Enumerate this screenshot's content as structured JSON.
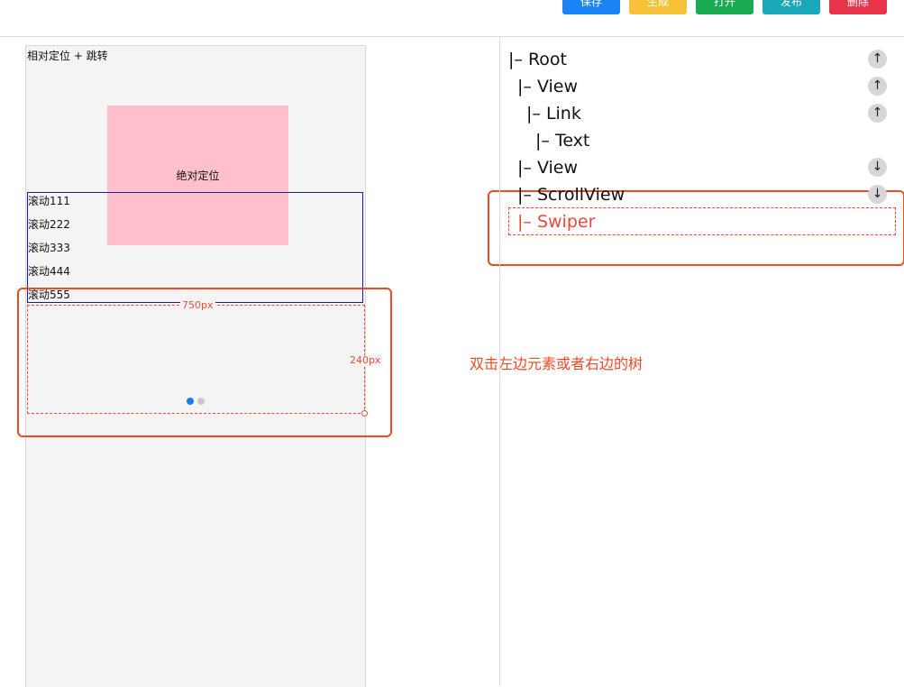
{
  "toolbar": {
    "buttons": [
      {
        "label": "保存",
        "color": "#1a84f7"
      },
      {
        "label": "生成",
        "color": "#f7c23a"
      },
      {
        "label": "打开",
        "color": "#1aaa52"
      },
      {
        "label": "发布",
        "color": "#1aa8b8"
      },
      {
        "label": "删除",
        "color": "#e8344b"
      }
    ]
  },
  "canvas": {
    "link_text": "相对定位 + 跳转",
    "absolute_box_text": "绝对定位",
    "scroll_items": [
      "滚动111",
      "滚动222",
      "滚动333",
      "滚动444",
      "滚动555"
    ],
    "swiper": {
      "width_label": "750px",
      "height_label": "240px",
      "active_dot_color": "#1a7cf0",
      "inactive_dot_color": "#c8c8c8"
    }
  },
  "hint": "双击左边元素或者右边的树",
  "tree": {
    "nodes": [
      {
        "label": "|– Root",
        "move": "up"
      },
      {
        "label": "|– View",
        "move": "up"
      },
      {
        "label": "|– Link",
        "move": "up"
      },
      {
        "label": "|– Text",
        "move": ""
      },
      {
        "label": "|– View",
        "move": "down"
      },
      {
        "label": "|– ScrollView",
        "move": "down"
      },
      {
        "label": "|– Swiper",
        "move": ""
      }
    ],
    "selected_color": "#e8473a"
  },
  "icons": {
    "up": "arrow-up-icon",
    "down": "arrow-down-icon"
  }
}
